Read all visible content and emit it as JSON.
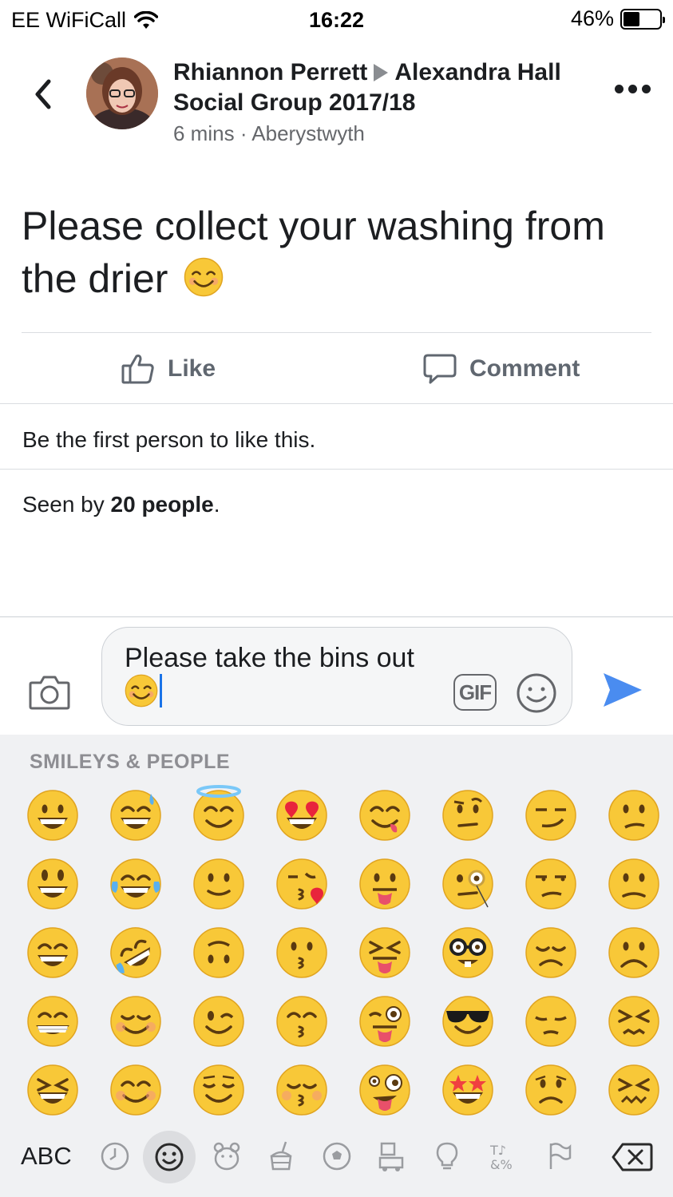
{
  "status_bar": {
    "carrier": "EE WiFiCall",
    "time": "16:22",
    "battery": "46%",
    "battery_level": 0.46
  },
  "header": {
    "author": "Rhiannon Perrett",
    "group": "Alexandra Hall Social Group 2017/18",
    "time_ago": "6 mins",
    "separator": "·",
    "location": "Aberystwyth"
  },
  "post": {
    "text": "Please collect your washing from the drier",
    "emoji_icon": "smiling-face-emoji"
  },
  "actions": {
    "like_label": "Like",
    "comment_label": "Comment"
  },
  "reactions": {
    "first_like_text": "Be the first person to like this."
  },
  "seen": {
    "prefix": "Seen by",
    "count_text": "20 people",
    "suffix": "."
  },
  "composer": {
    "text": "Please take the bins out",
    "gif_label": "GIF"
  },
  "keyboard": {
    "category_title": "SMILEYS & PEOPLE",
    "abc_label": "ABC",
    "emoji_rows": [
      [
        "grinning",
        "sweat-smile",
        "innocent",
        "heart-eyes",
        "yum",
        "raised-eyebrow",
        "smirk",
        "confused"
      ],
      [
        "smiley",
        "joy",
        "slightly-smiling",
        "kissing-heart",
        "tongue",
        "monocle",
        "unamused",
        "slightly-frowning"
      ],
      [
        "smile",
        "rofl",
        "upside-down",
        "kissing",
        "squint-tongue",
        "nerd",
        "disappointed",
        "frowning"
      ],
      [
        "grin",
        "relaxed",
        "wink",
        "kissing-smiling-eyes",
        "winking-tongue",
        "sunglasses",
        "pensive",
        "persevere"
      ],
      [
        "laughing",
        "blush",
        "relieved",
        "kissing-closed-eyes",
        "zany",
        "star-struck",
        "worried",
        "confounded"
      ]
    ],
    "category_icons": [
      "recent-clock-icon",
      "smileys-icon",
      "animals-icon",
      "food-icon",
      "activity-ball-icon",
      "travel-icon",
      "objects-bulb-icon",
      "symbols-icon",
      "flags-icon"
    ]
  },
  "colors": {
    "text_primary": "#1c1e21",
    "text_secondary": "#65676b",
    "send_blue": "#4a8cf0",
    "emoji_yellow": "#f8c838"
  }
}
